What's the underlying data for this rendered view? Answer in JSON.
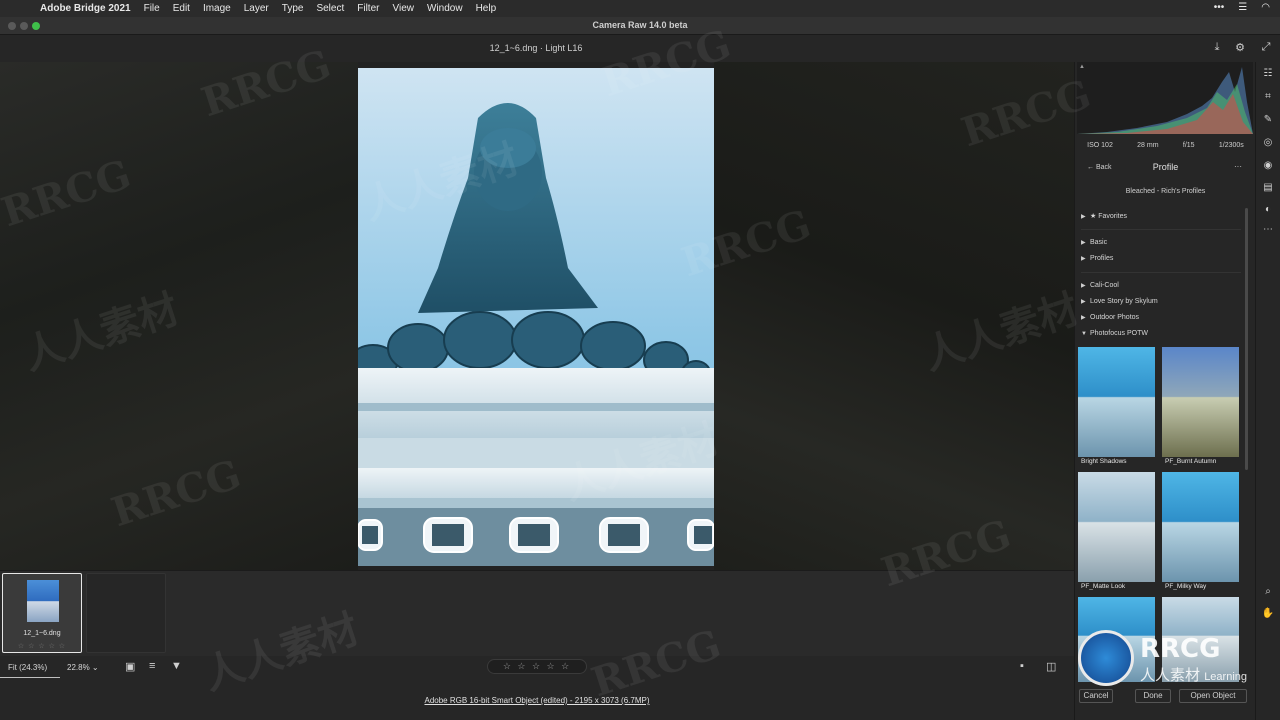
{
  "menubar": {
    "app_name": "Adobe Bridge 2021",
    "items": [
      "File",
      "Edit",
      "Image",
      "Layer",
      "Type",
      "Select",
      "Filter",
      "View",
      "Window",
      "Help"
    ]
  },
  "window": {
    "title": "Camera Raw 14.0 beta"
  },
  "toolbar": {
    "filename": "12_1~6.dng  ·  Light L16"
  },
  "exif": {
    "iso": "ISO 102",
    "focal": "28 mm",
    "aperture": "f/15",
    "shutter": "1/2300s"
  },
  "profile_panel": {
    "back_label": "Back",
    "title": "Profile",
    "more": "···",
    "current_profile": "Bleached - Rich's Profiles",
    "groups": [
      {
        "label": "Favorites",
        "star": "★"
      },
      {
        "label": "Basic"
      },
      {
        "label": "Profiles"
      },
      {
        "label": "Cali-Cool"
      },
      {
        "label": "Love Story by Skylum"
      },
      {
        "label": "Outdoor Photos"
      },
      {
        "label": "Photofocus POTW",
        "expanded": true
      }
    ],
    "thumbnails": [
      "Bright Shadows",
      "PF_Burnt Autumn",
      "PF_Matte Look",
      "PF_Milky Way",
      "",
      ""
    ],
    "cancel_label": "Cancel",
    "done_label": "Done",
    "open_label": "Open Object"
  },
  "filmstrip": {
    "items": [
      {
        "name": "12_1~6.dng",
        "stars": "☆ ☆ ☆ ☆ ☆"
      }
    ]
  },
  "bottombar": {
    "fit_label": "Fit (24.3%)",
    "zoom_value": "22.8%",
    "zoom_caret": "⌄",
    "rating_stars": "☆ ☆ ☆ ☆ ☆",
    "color_info": "Adobe RGB 16-bit Smart Object (edited) - 2195 x 3073 (6.7MP)"
  },
  "colors": {
    "accent": "#2e8bd8",
    "panel_bg": "#262626",
    "canvas_bg": "#222222"
  },
  "watermarks": [
    "RRCG",
    "人人素材"
  ],
  "logo": {
    "main": "RRCG",
    "sub": "人人素材",
    "tag": "Learning"
  }
}
